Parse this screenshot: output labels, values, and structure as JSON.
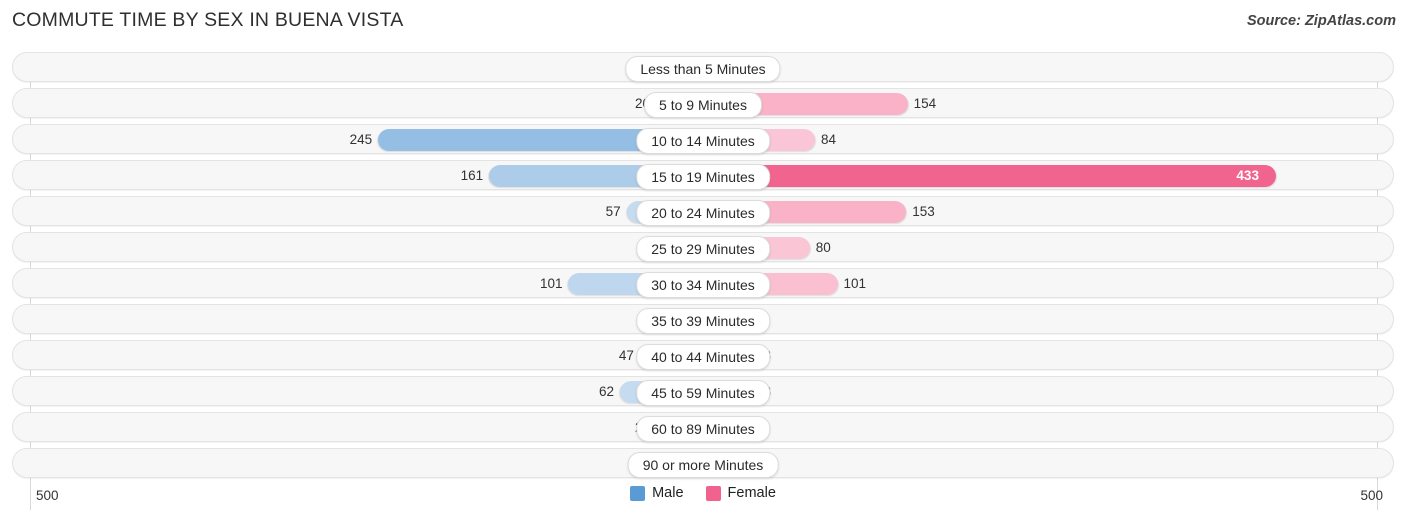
{
  "header": {
    "title": "COMMUTE TIME BY SEX IN BUENA VISTA",
    "source": "Source: ZipAtlas.com"
  },
  "axis": {
    "left_label": "500",
    "right_label": "500"
  },
  "legend": {
    "items": [
      {
        "label": "Male",
        "color": "#5b9bd5"
      },
      {
        "label": "Female",
        "color": "#f2628f"
      }
    ]
  },
  "chart_data": {
    "type": "bar",
    "orientation": "horizontal-diverging",
    "title": "COMMUTE TIME BY SEX IN BUENA VISTA",
    "xlabel": "",
    "ylabel": "",
    "xlim": [
      -500,
      500
    ],
    "axis_max": 500,
    "grid": true,
    "legend_position": "bottom-center",
    "categories": [
      "Less than 5 Minutes",
      "5 to 9 Minutes",
      "10 to 14 Minutes",
      "15 to 19 Minutes",
      "20 to 24 Minutes",
      "25 to 29 Minutes",
      "30 to 34 Minutes",
      "35 to 39 Minutes",
      "40 to 44 Minutes",
      "45 to 59 Minutes",
      "60 to 89 Minutes",
      "90 or more Minutes"
    ],
    "series": [
      {
        "name": "Male",
        "color": "#5b9bd5",
        "values": [
          0,
          20,
          245,
          161,
          57,
          0,
          101,
          0,
          47,
          62,
          21,
          0
        ]
      },
      {
        "name": "Female",
        "color": "#f2628f",
        "values": [
          0,
          154,
          84,
          433,
          153,
          80,
          101,
          0,
          23,
          33,
          0,
          0
        ]
      }
    ]
  },
  "rows": [
    {
      "label": "Less than 5 Minutes",
      "male": "0",
      "female": "0"
    },
    {
      "label": "5 to 9 Minutes",
      "male": "20",
      "female": "154"
    },
    {
      "label": "10 to 14 Minutes",
      "male": "245",
      "female": "84"
    },
    {
      "label": "15 to 19 Minutes",
      "male": "161",
      "female": "433"
    },
    {
      "label": "20 to 24 Minutes",
      "male": "57",
      "female": "153"
    },
    {
      "label": "25 to 29 Minutes",
      "male": "0",
      "female": "80"
    },
    {
      "label": "30 to 34 Minutes",
      "male": "101",
      "female": "101"
    },
    {
      "label": "35 to 39 Minutes",
      "male": "0",
      "female": "0"
    },
    {
      "label": "40 to 44 Minutes",
      "male": "47",
      "female": "23"
    },
    {
      "label": "45 to 59 Minutes",
      "male": "62",
      "female": "33"
    },
    {
      "label": "60 to 89 Minutes",
      "male": "21",
      "female": "0"
    },
    {
      "label": "90 or more Minutes",
      "male": "0",
      "female": "0"
    }
  ]
}
